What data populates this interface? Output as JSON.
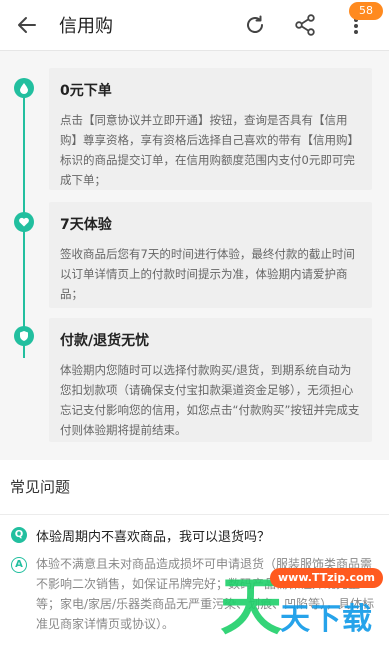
{
  "header": {
    "title": "信用购",
    "badge_count": "58",
    "icons": [
      "back-arrow-icon",
      "refresh-icon",
      "share-icon",
      "more-vertical-icon"
    ]
  },
  "steps": [
    {
      "icon": "drop-icon",
      "title": "0元下单",
      "desc": "点击【同意协议并立即开通】按钮，查询是否具有【信用购】尊享资格，享有资格后选择自己喜欢的带有【信用购】标识的商品提交订单，在信用购额度范围内支付0元即可完成下单；"
    },
    {
      "icon": "heart-icon",
      "title": "7天体验",
      "desc": "签收商品后您有7天的时间进行体验，最终付款的截止时间以订单详情页上的付款时间提示为准，体验期内请爱护商品；"
    },
    {
      "icon": "shield-icon",
      "title": "付款/退货无忧",
      "desc": "体验期内您随时可以选择付款购买/退货，到期系统自动为您扣划款项（请确保支付宝扣款渠道资金足够），无须担心忘记支付影响您的信用，如您点击“付款购买”按钮并完成支付则体验期将提前结束。"
    }
  ],
  "faq": {
    "header": "常见问题",
    "q_mark": "Q",
    "a_mark": "A",
    "question": "体验周期内不喜欢商品，我可以退货吗？",
    "answer": "体验不满意且未对商品造成损坏可申请退货（服装服饰类商品需不影响二次销售，如保证吊牌完好；数码产品需保证外观完整等；家电/家居/乐器类商品无严重污染、划痕、凹陷等），具体标准见商家详情页或协议）。"
  },
  "watermark": {
    "char": "天",
    "url": "www.TTzip.com",
    "text": "天下载"
  },
  "colors": {
    "accent": "#22bf9f",
    "badge": "#ff8a1f",
    "card_bg": "#efefef"
  }
}
